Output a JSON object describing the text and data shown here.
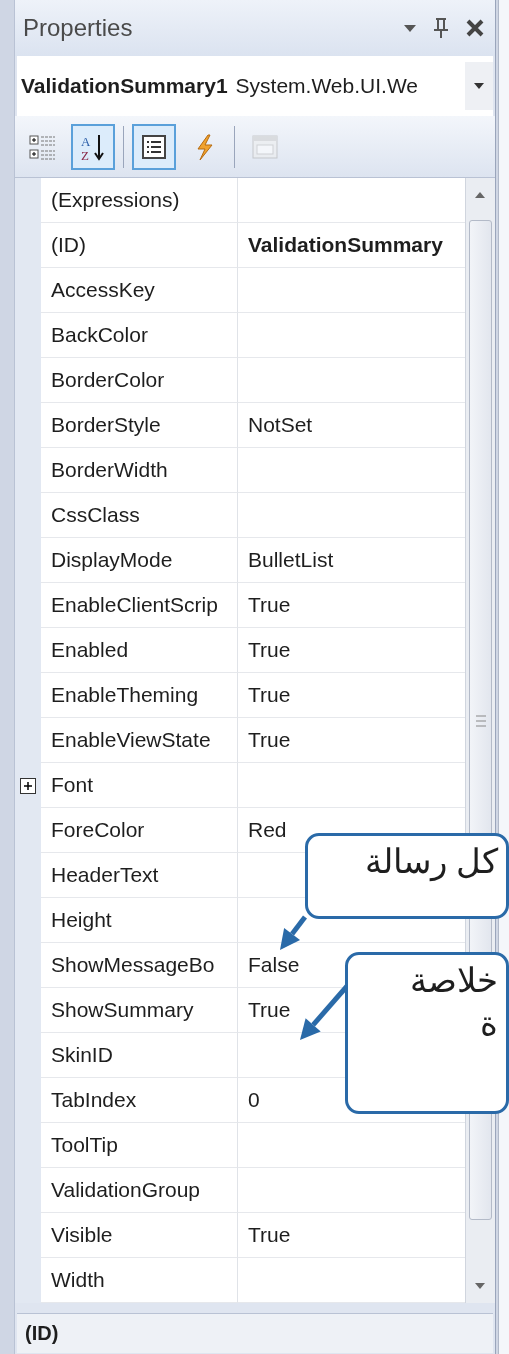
{
  "window": {
    "title": "Properties"
  },
  "object_selector": {
    "name": "ValidationSummary1",
    "type": "System.Web.UI.We"
  },
  "toolbar": [
    {
      "kind": "categorized",
      "selected": false,
      "disabled": false
    },
    {
      "kind": "alphabetical",
      "selected": true,
      "disabled": false,
      "letter_top": "A",
      "letter_bottom": "Z"
    },
    {
      "kind": "separator"
    },
    {
      "kind": "properties",
      "selected": true,
      "disabled": false
    },
    {
      "kind": "events",
      "selected": false,
      "disabled": false
    },
    {
      "kind": "separator"
    },
    {
      "kind": "property_pages",
      "selected": false,
      "disabled": true
    }
  ],
  "properties": [
    {
      "name": "(Expressions)",
      "expandable": false
    },
    {
      "name": "(ID)",
      "value": "ValidationSummary",
      "modified": true,
      "expandable": false
    },
    {
      "name": "AccessKey",
      "expandable": false
    },
    {
      "name": "BackColor",
      "expandable": false
    },
    {
      "name": "BorderColor",
      "expandable": false
    },
    {
      "name": "BorderStyle",
      "value": "NotSet",
      "modified": false,
      "expandable": false
    },
    {
      "name": "BorderWidth",
      "expandable": false
    },
    {
      "name": "CssClass",
      "expandable": false
    },
    {
      "name": "DisplayMode",
      "value": "BulletList",
      "modified": false,
      "expandable": false
    },
    {
      "name": "EnableClientScrip",
      "value": "True",
      "modified": false,
      "expandable": false
    },
    {
      "name": "Enabled",
      "value": "True",
      "modified": false,
      "expandable": false
    },
    {
      "name": "EnableTheming",
      "value": "True",
      "modified": false,
      "expandable": false
    },
    {
      "name": "EnableViewState",
      "value": "True",
      "modified": false,
      "expandable": false
    },
    {
      "name": "Font",
      "expandable": true
    },
    {
      "name": "ForeColor",
      "value": "Red",
      "modified": false,
      "expandable": false
    },
    {
      "name": "HeaderText",
      "expandable": false
    },
    {
      "name": "Height",
      "expandable": false
    },
    {
      "name": "ShowMessageBo",
      "value": "False",
      "modified": false,
      "expandable": false
    },
    {
      "name": "ShowSummary",
      "value": "True",
      "modified": false,
      "expandable": false
    },
    {
      "name": "SkinID",
      "expandable": false
    },
    {
      "name": "TabIndex",
      "value": "0",
      "modified": false,
      "expandable": false
    },
    {
      "name": "ToolTip",
      "expandable": false
    },
    {
      "name": "ValidationGroup",
      "expandable": false
    },
    {
      "name": "Visible",
      "value": "True",
      "modified": false,
      "expandable": false
    },
    {
      "name": "Width",
      "expandable": false
    }
  ],
  "description": {
    "title": "(ID)"
  },
  "callouts": [
    {
      "lines": [
        "كل رسالة"
      ]
    },
    {
      "lines": [
        "خلاصة",
        "ة"
      ]
    }
  ]
}
